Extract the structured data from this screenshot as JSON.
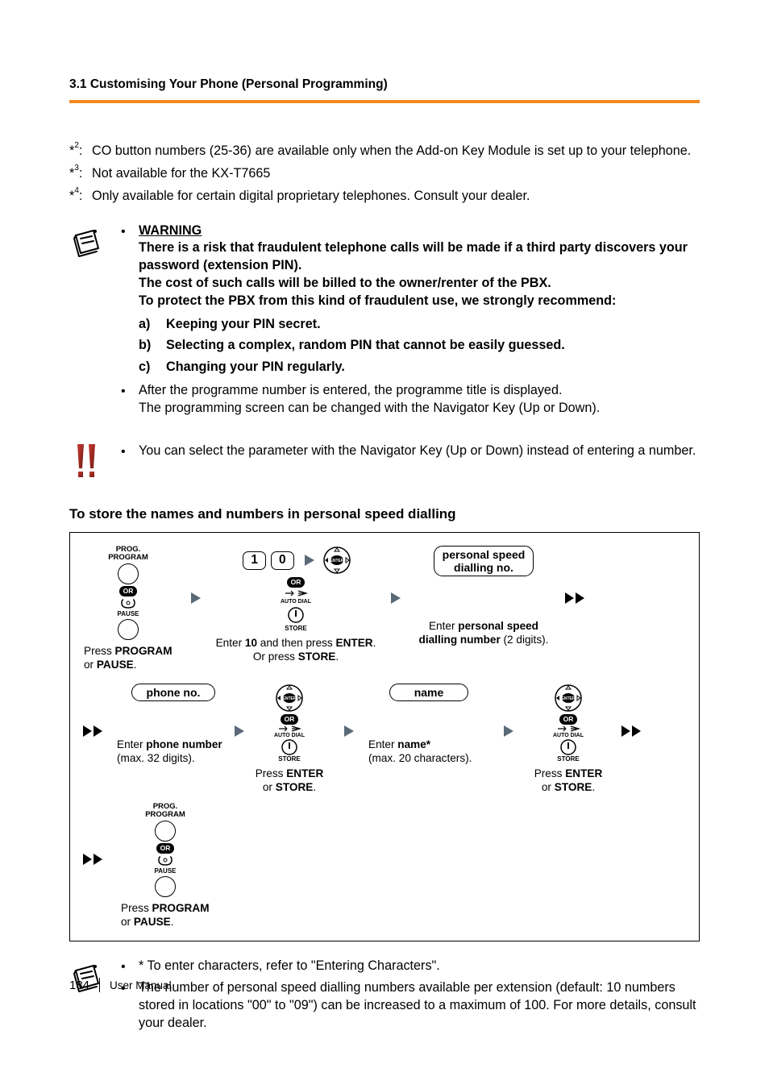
{
  "header": {
    "section": "3.1 Customising Your Phone (Personal Programming)"
  },
  "footnotes": [
    {
      "mark": "*",
      "sup": "2",
      "text": "CO button numbers (25-36) are available only when the Add-on Key Module is set up to your telephone."
    },
    {
      "mark": "*",
      "sup": "3",
      "text": "Not available for the KX-T7665"
    },
    {
      "mark": "*",
      "sup": "4",
      "text": "Only available for certain digital proprietary telephones. Consult your dealer."
    }
  ],
  "warning": {
    "title": "WARNING",
    "lines": [
      "There is a risk that fraudulent telephone calls will be made if a third party discovers your password (extension PIN).",
      "The cost of such calls will be billed to the owner/renter of the PBX.",
      "To protect the PBX from this kind of fraudulent use, we strongly recommend:"
    ],
    "list": [
      {
        "lbl": "a)",
        "text": "Keeping your PIN secret."
      },
      {
        "lbl": "b)",
        "text": "Selecting a complex, random PIN that cannot be easily guessed."
      },
      {
        "lbl": "c)",
        "text": "Changing your PIN regularly."
      }
    ],
    "after": [
      "After the programme number is entered, the programme title is displayed.",
      "The programming screen can be changed with the Navigator Key (Up or Down)."
    ]
  },
  "tip": {
    "text": "You can select the parameter with the Navigator Key (Up or Down) instead of entering a number."
  },
  "subhead": "To store the names and numbers in personal speed dialling",
  "flow": {
    "prog_program": "PROG.\nPROGRAM",
    "or": "OR",
    "pause": "PAUSE",
    "cap1a": "Press ",
    "cap1b": "PROGRAM",
    "cap1c": "or ",
    "cap1d": "PAUSE",
    "cap1e": ".",
    "k1": "1",
    "k0": "0",
    "enter": "ENTER",
    "auto_dial_top": "AUTO DIAL",
    "store": "STORE",
    "cap2a": "Enter ",
    "cap2b": "10",
    "cap2c": " and then press ",
    "cap2d": "ENTER",
    "cap2e": ".",
    "cap2f": "Or press ",
    "cap2g": "STORE",
    "cap2h": ".",
    "pill_psd": "personal speed\ndialling no.",
    "cap3a": "Enter ",
    "cap3b": "personal speed",
    "cap3c": "dialling number",
    "cap3d": " (2 digits).",
    "pill_phone": "phone no.",
    "cap4a": "Enter ",
    "cap4b": "phone number",
    "cap4c": "(max. 32 digits).",
    "cap5a": "Press ",
    "cap5b": "ENTER",
    "cap5c": "or ",
    "cap5d": "STORE",
    "cap5e": ".",
    "pill_name": "name",
    "cap6a": "Enter ",
    "cap6b": "name*",
    "cap6c": "(max. 20 characters).",
    "cap7a": "Press ",
    "cap7b": "PROGRAM",
    "cap7c": "or ",
    "cap7d": "PAUSE",
    "cap7e": "."
  },
  "note2": {
    "b1": "* To enter characters, refer to \"Entering Characters\".",
    "b2": "The number of personal speed dialling numbers available per extension (default: 10 numbers stored in locations \"00\" to \"09\") can be increased to a maximum of 100. For more details, consult your dealer."
  },
  "footer": {
    "page": "184",
    "label": "User Manual"
  }
}
